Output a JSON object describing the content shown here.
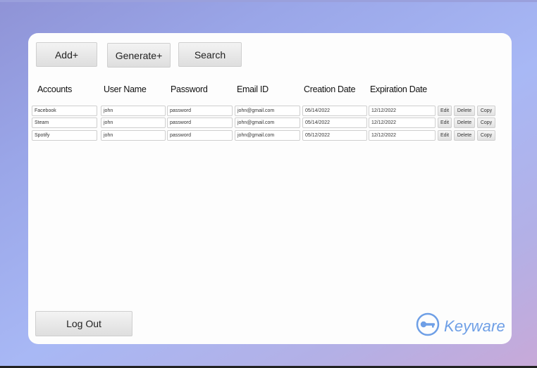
{
  "toolbar": {
    "add_label": "Add+",
    "generate_label": "Generate+",
    "search_label": "Search"
  },
  "table": {
    "headers": [
      "Accounts",
      "User Name",
      "Password",
      "Email ID",
      "Creation Date",
      "Expiration Date"
    ],
    "rows": [
      {
        "account": "Facebook",
        "username": "john",
        "password": "password",
        "email": "john@gmail.com",
        "created": "05/14/2022",
        "expires": "12/12/2022"
      },
      {
        "account": "Steam",
        "username": "john",
        "password": "password",
        "email": "john@gmail.com",
        "created": "05/14/2022",
        "expires": "12/12/2022"
      },
      {
        "account": "Spotify",
        "username": "john",
        "password": "password",
        "email": "john@gmail.com",
        "created": "05/12/2022",
        "expires": "12/12/2022"
      }
    ],
    "row_actions": {
      "edit": "Edit",
      "delete": "Delete",
      "copy": "Copy"
    }
  },
  "footer": {
    "logout_label": "Log Out",
    "brand": "Keyware"
  },
  "colors": {
    "brand": "#6e9fe6"
  },
  "icons": {
    "brand_logo": "key-icon"
  }
}
